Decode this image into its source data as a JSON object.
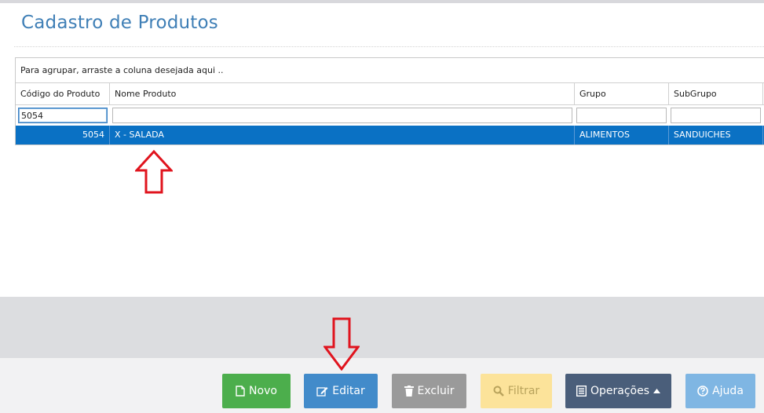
{
  "page": {
    "title": "Cadastro de Produtos"
  },
  "grid": {
    "group_hint": "Para agrupar, arraste a coluna desejada aqui ..",
    "columns": [
      "Código do Produto",
      "Nome Produto",
      "Grupo",
      "SubGrupo"
    ],
    "filters": {
      "codigo": "5054",
      "nome": "",
      "grupo": "",
      "subgrupo": ""
    },
    "rows": [
      {
        "codigo": "5054",
        "nome": "X - SALADA",
        "grupo": "ALIMENTOS",
        "subgrupo": "SANDUICHES"
      }
    ]
  },
  "toolbar": {
    "novo": "Novo",
    "editar": "Editar",
    "excluir": "Excluir",
    "filtrar": "Filtrar",
    "operacoes": "Operações",
    "ajuda": "Ajuda"
  },
  "icons": {
    "novo": "file-icon",
    "editar": "edit-icon",
    "excluir": "trash-icon",
    "filtrar": "search-icon",
    "operacoes": "list-icon",
    "ajuda": "help-icon",
    "annotation": "up-arrow-annotation / down-arrow-annotation"
  },
  "colors": {
    "selected_row": "#0a71c4",
    "novo": "#4cae4c",
    "editar": "#428bca",
    "excluir": "#9a9a9a",
    "filtrar": "#fce39a",
    "operacoes": "#4a5e7a",
    "ajuda": "#7fb6e3",
    "annotation_arrow": "#e0141e"
  }
}
